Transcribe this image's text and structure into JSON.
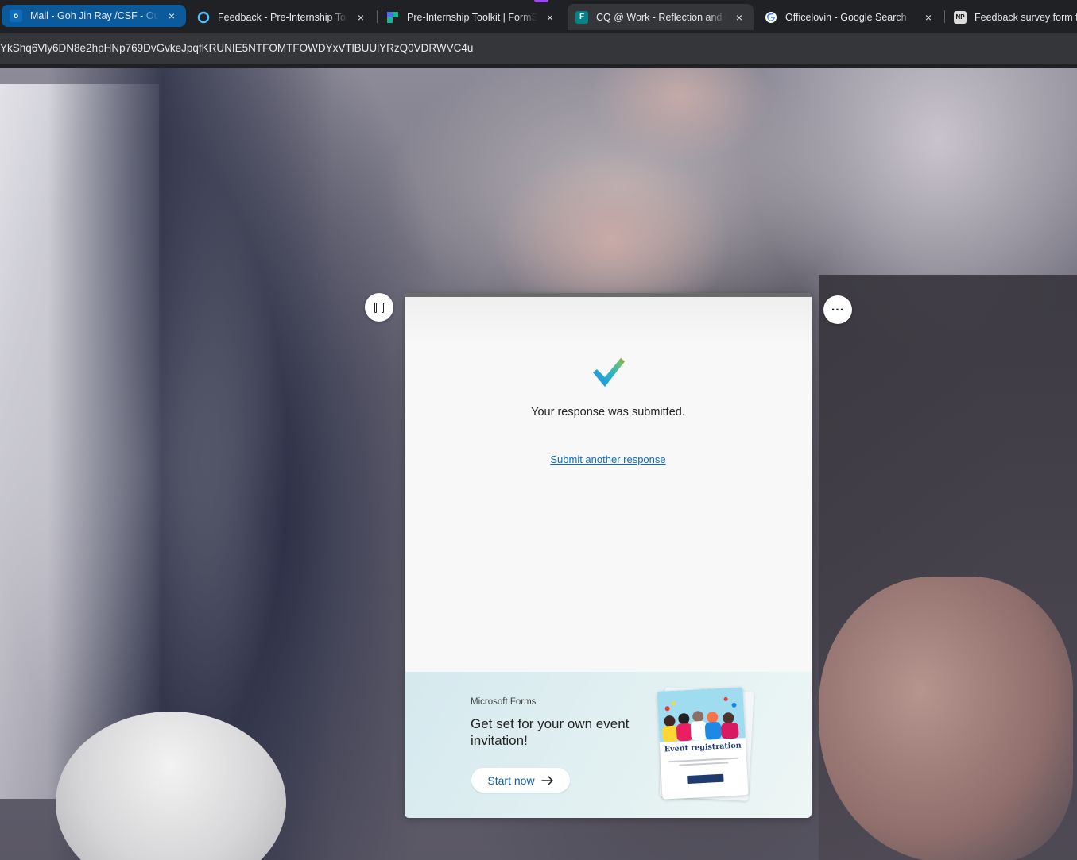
{
  "browser": {
    "tabs": [
      {
        "title": "Mail - Goh Jin Ray /CSF - Outlook",
        "favicon": "outlook-icon",
        "color": "#0a5a9c"
      },
      {
        "title": "Feedback - Pre-Internship Toolkit",
        "favicon": "circle-icon",
        "color": "#4cc2ff"
      },
      {
        "title": "Pre-Internship Toolkit | FormSG",
        "favicon": "formsg-icon",
        "color": "#4a6cf7"
      },
      {
        "title": "CQ @ Work - Reflection and Feedback",
        "favicon": "forms-icon",
        "color": "#038387"
      },
      {
        "title": "Officelovin - Google Search",
        "favicon": "google-icon",
        "color": "#4285f4"
      },
      {
        "title": "Feedback survey form fo",
        "favicon": "np-icon",
        "color": "#111111"
      }
    ],
    "tab_close_glyph": "×",
    "address_bar": {
      "url": "YkShq6Vly6DN8e2hpHNp769DvGvkeJpqfKRUNIE5NTFOMTFOWDYxVTlBUUlYRzQ0VDRWVC4u"
    }
  },
  "form": {
    "confirmation": "Your response was submitted.",
    "submit_another": "Submit another response"
  },
  "promo": {
    "brand": "Microsoft Forms",
    "title": "Get set for your own event invitation!",
    "cta": "Start now",
    "illustration_title": "Event registration"
  },
  "colors": {
    "accent": "#0f6cbd",
    "check_green": "#6cc24a",
    "check_blue": "#1e88e5"
  }
}
